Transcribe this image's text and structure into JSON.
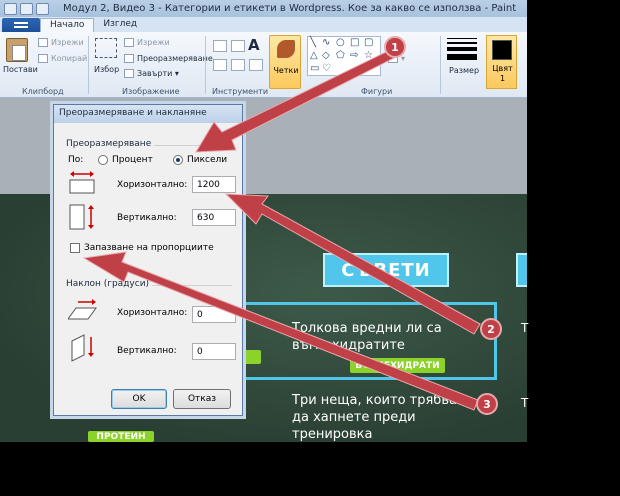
{
  "window": {
    "title": "Модул 2, Видео 3 - Категории и етикети в Wordpress. Кое за какво се използва - Paint"
  },
  "tabs": [
    {
      "label": "Начало",
      "active": true
    },
    {
      "label": "Изглед",
      "active": false
    }
  ],
  "ribbon": {
    "clipboard": {
      "paste": "Постави",
      "cut": "Изрежи",
      "copy": "Копирай",
      "group": "Клипборд"
    },
    "image": {
      "select": "Избор",
      "crop": "Изрежи",
      "resize": "Преоразмеряване",
      "rotate": "Завърти",
      "group": "Изображение"
    },
    "tools": {
      "group": "Инструменти"
    },
    "brushes": {
      "label": "Четки"
    },
    "shapes": {
      "group": "Фигури"
    },
    "size": {
      "label": "Размер"
    },
    "color": {
      "label": "Цвят",
      "sub": "1",
      "swatch": "#000000"
    }
  },
  "dialog": {
    "title": "Преоразмеряване и накланяне",
    "resize_section": "Преоразмеряване",
    "by_label": "По:",
    "option_percent": "Процент",
    "option_pixels": "Пиксели",
    "selected_option": "pixels",
    "horizontal_label": "Хоризонтално:",
    "horizontal_value": "1200",
    "vertical_label": "Вертикално:",
    "vertical_value": "630",
    "keep_ratio_label": "Запазване на пропорциите",
    "keep_ratio_checked": false,
    "skew_section": "Наклон (градуси)",
    "skew_horizontal_label": "Хоризонтално:",
    "skew_horizontal_value": "0",
    "skew_vertical_label": "Вертикално:",
    "skew_vertical_value": "0",
    "ok": "OK",
    "cancel": "Отказ"
  },
  "canvas": {
    "heading": "СЪВЕТИ",
    "item1": "Толкова вредни ли са въглехидратите",
    "pill1": "ВЪГЛЕХИДРАТИ",
    "item2": "Три неща, които трябва да хапнете преди тренировка",
    "pill2": "ПРОТЕИН",
    "edge1": "Т",
    "edge2": "Т"
  },
  "annotations": {
    "badge1": "1",
    "badge2": "2",
    "badge3": "3",
    "color": "#c04048"
  }
}
